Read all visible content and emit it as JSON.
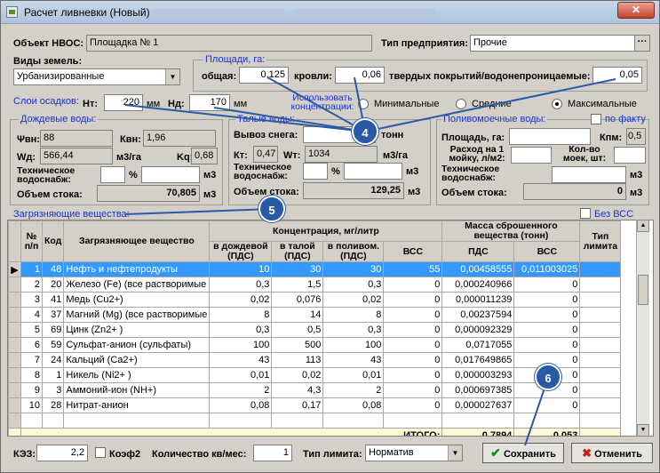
{
  "window": {
    "title": "Расчет ливневки (Новый)",
    "close_label": "✕"
  },
  "header": {
    "object_label": "Объект НВОС:",
    "object_value": "Площадка № 1",
    "enterprise_label": "Тип предприятия:",
    "enterprise_value": "Прочие",
    "enterprise_btn": "···"
  },
  "land": {
    "label": "Виды земель:",
    "value": "Урбанизированные"
  },
  "areas": {
    "group_label": "Площади, га:",
    "total_label": "общая:",
    "total_value": "0,125",
    "roof_label": "кровли:",
    "roof_value": "0,06",
    "hard_label": "твердых покрытий/водонепроницаемые:",
    "hard_value": "0,05"
  },
  "concentration": {
    "label": "Использовать концентрации:",
    "min": "Минимальные",
    "mid": "Средние",
    "max": "Максимальные"
  },
  "precip": {
    "label": "Слои осадков:",
    "ht_label": "Нт:",
    "ht_value": "220",
    "ht_unit": "мм",
    "hd_label": "Нд:",
    "hd_value": "170",
    "hd_unit": "мм"
  },
  "rain": {
    "group_label": "Дождевые воды:",
    "psi_label": "Ψвн:",
    "psi_value": "88",
    "kvn_label": "Квн:",
    "kvn_value": "1,96",
    "wd_label": "Wд:",
    "wd_value": "566,44",
    "wd_unit": "м3/га",
    "kq_label": "Kq:",
    "kq_value": "0,68",
    "tech_label": "Техническое водоснабж:",
    "pct": "%",
    "m3": "м3",
    "volume_label": "Объем стока:",
    "volume_value": "70,805",
    "volume_unit": "м3"
  },
  "melt": {
    "group_label": "Талые воды:",
    "snow_label": "Вывоз снега:",
    "snow_unit": "тонн",
    "kt_label": "Кт:",
    "kt_value": "0,47",
    "wt_label": "Wт:",
    "wt_value": "1034",
    "wt_unit": "м3/га",
    "tech_label": "Техническое водоснабж:",
    "pct": "%",
    "m3": "м3",
    "volume_label": "Объем стока:",
    "volume_value": "129,25",
    "volume_unit": "м3"
  },
  "wash": {
    "group_label": "Поливомоечные воды:",
    "by_fact": "по факту",
    "area_label": "Площадь, га:",
    "kpm_label": "Кпм:",
    "kpm_value": "0,5",
    "flow_label": "Расход на 1 мойку, л/м2:",
    "count_label": "Кол-во моек, шт:",
    "tech_label": "Техническое водоснабж:",
    "m3": "м3",
    "volume_label": "Объем стока:",
    "volume_value": "0",
    "volume_unit": "м3"
  },
  "pollutants": {
    "group_label": "Загрязняющие вещества:",
    "no_vss": "Без ВСС",
    "headers": {
      "num": "№ п/п",
      "code": "Код",
      "name": "Загрязняющее вещество",
      "conc": "Концентрация, мг/литр",
      "rain": "в дождевой (ПДС)",
      "melt": "в талой (ПДС)",
      "wash": "в поливом. (ПДС)",
      "vss": "ВСС",
      "mass": "Масса сброшенного вещества (тонн)",
      "pds": "ПДС",
      "vss2": "ВСС",
      "limit": "Тип лимита"
    },
    "rows": [
      {
        "n": "1",
        "code": "48",
        "name": "Нефть и нефтепродукты",
        "rain": "10",
        "melt": "30",
        "wash": "30",
        "vss": "55",
        "pds": "0,00458555",
        "vss2": "0,011003025"
      },
      {
        "n": "2",
        "code": "20",
        "name": "Железо (Fe) (все растворимые",
        "rain": "0,3",
        "melt": "1,5",
        "wash": "0,3",
        "vss": "0",
        "pds": "0,000240966",
        "vss2": "0"
      },
      {
        "n": "3",
        "code": "41",
        "name": "Медь (Cu2+)",
        "rain": "0,02",
        "melt": "0,076",
        "wash": "0,02",
        "vss": "0",
        "pds": "0,000011239",
        "vss2": "0"
      },
      {
        "n": "4",
        "code": "37",
        "name": "Магний (Mg) (все растворимые",
        "rain": "8",
        "melt": "14",
        "wash": "8",
        "vss": "0",
        "pds": "0,00237594",
        "vss2": "0"
      },
      {
        "n": "5",
        "code": "69",
        "name": "Цинк (Zn2+ )",
        "rain": "0,3",
        "melt": "0,5",
        "wash": "0,3",
        "vss": "0",
        "pds": "0,000092329",
        "vss2": "0"
      },
      {
        "n": "6",
        "code": "59",
        "name": "Сульфат-анион (сульфаты)",
        "rain": "100",
        "melt": "500",
        "wash": "100",
        "vss": "0",
        "pds": "0,0717055",
        "vss2": "0"
      },
      {
        "n": "7",
        "code": "24",
        "name": "Кальций (Ca2+)",
        "rain": "43",
        "melt": "113",
        "wash": "43",
        "vss": "0",
        "pds": "0,017649865",
        "vss2": "0"
      },
      {
        "n": "8",
        "code": "1",
        "name": "Никель (Ni2+ )",
        "rain": "0,01",
        "melt": "0,02",
        "wash": "0,01",
        "vss": "0",
        "pds": "0,000003293",
        "vss2": "0"
      },
      {
        "n": "9",
        "code": "3",
        "name": "Аммоний-ион (NH+)",
        "rain": "2",
        "melt": "4,3",
        "wash": "2",
        "vss": "0",
        "pds": "0,000697385",
        "vss2": "0"
      },
      {
        "n": "10",
        "code": "28",
        "name": "Нитрат-анион",
        "rain": "0,08",
        "melt": "0,17",
        "wash": "0,08",
        "vss": "0",
        "pds": "0,000027637",
        "vss2": "0"
      }
    ],
    "total": {
      "label": "ИТОГО:",
      "pds": "0,7894",
      "vss": "0,053"
    }
  },
  "footer": {
    "kez_label": "КЭЗ:",
    "kez_value": "2,2",
    "koef2_label": "Коэф2",
    "qty_label": "Количество кв/мес:",
    "qty_value": "1",
    "limit_label": "Тип лимита:",
    "limit_value": "Норматив",
    "save_label": "Сохранить",
    "cancel_label": "Отменить"
  },
  "callouts": {
    "c4": "4",
    "c5": "5",
    "c6": "6"
  },
  "colors": {
    "callout": "#2a5aa6",
    "selection": "#3399ff",
    "label_blue": "#1a33cc"
  }
}
